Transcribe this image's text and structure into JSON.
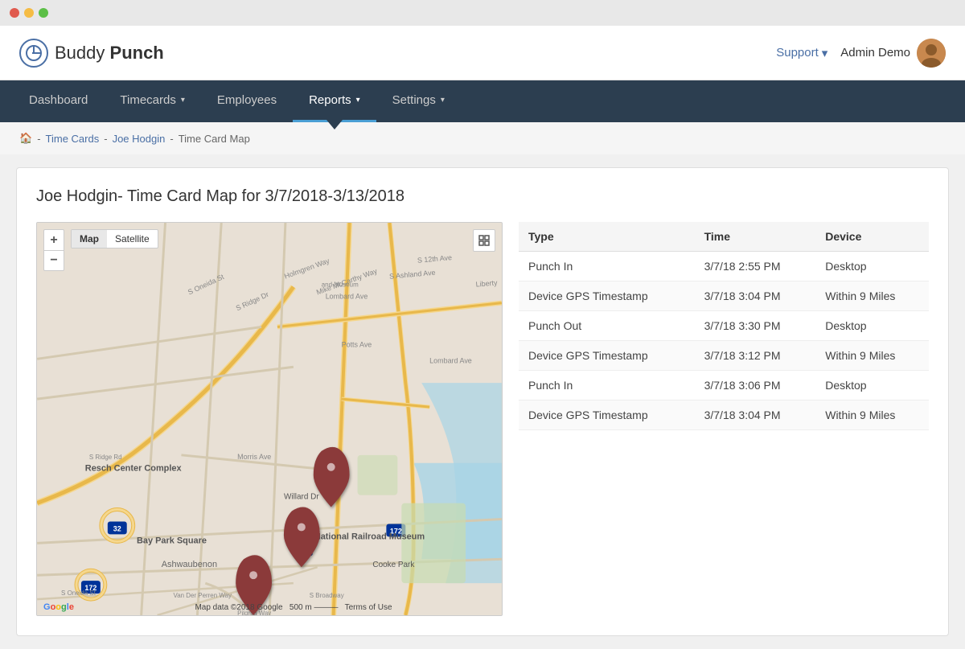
{
  "titleBar": {
    "dots": [
      "red",
      "yellow",
      "green"
    ]
  },
  "topBar": {
    "logo": {
      "buddy": "Buddy",
      "punch": "Punch"
    },
    "support": "Support",
    "user": "Admin Demo"
  },
  "nav": {
    "items": [
      {
        "id": "dashboard",
        "label": "Dashboard",
        "hasDropdown": false,
        "active": false
      },
      {
        "id": "timecards",
        "label": "Timecards",
        "hasDropdown": true,
        "active": false
      },
      {
        "id": "employees",
        "label": "Employees",
        "hasDropdown": false,
        "active": false
      },
      {
        "id": "reports",
        "label": "Reports",
        "hasDropdown": true,
        "active": true
      },
      {
        "id": "settings",
        "label": "Settings",
        "hasDropdown": true,
        "active": false
      }
    ]
  },
  "breadcrumb": {
    "home": "🏠",
    "sep1": "-",
    "link1": "Time Cards",
    "sep2": "-",
    "link2": "Joe Hodgin",
    "sep3": "-",
    "current": "Time Card Map"
  },
  "card": {
    "title": "Joe Hodgin- Time Card Map for 3/7/2018-3/13/2018"
  },
  "mapControls": {
    "zoomIn": "+",
    "zoomOut": "−",
    "mapLabel": "Map",
    "satelliteLabel": "Satellite"
  },
  "table": {
    "columns": [
      "Type",
      "Time",
      "Device"
    ],
    "rows": [
      {
        "type": "Punch In",
        "time": "3/7/18 2:55 PM",
        "device": "Desktop"
      },
      {
        "type": "Device GPS Timestamp",
        "time": "3/7/18 3:04 PM",
        "device": "Within 9 Miles"
      },
      {
        "type": "Punch Out",
        "time": "3/7/18 3:30 PM",
        "device": "Desktop"
      },
      {
        "type": "Device GPS Timestamp",
        "time": "3/7/18 3:12 PM",
        "device": "Within 9 Miles"
      },
      {
        "type": "Punch In",
        "time": "3/7/18 3:06 PM",
        "device": "Desktop"
      },
      {
        "type": "Device GPS Timestamp",
        "time": "3/7/18 3:04 PM",
        "device": "Within 9 Miles"
      }
    ]
  },
  "mapFooter": {
    "google": "Google",
    "mapData": "Map data ©2018 Google",
    "scale": "500 m",
    "terms": "Terms of Use"
  }
}
